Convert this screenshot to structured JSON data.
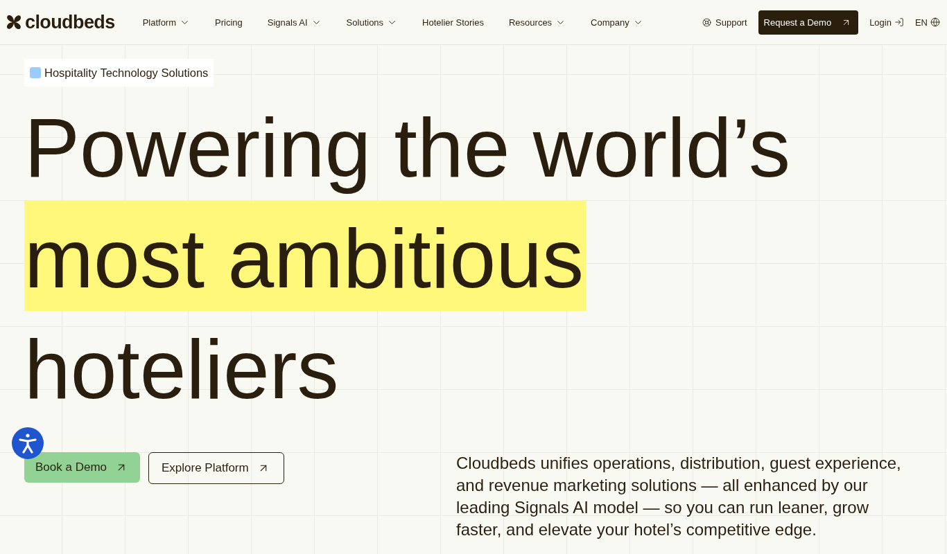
{
  "header": {
    "logo": "cloudbeds",
    "nav": [
      {
        "label": "Platform",
        "has_menu": true
      },
      {
        "label": "Pricing",
        "has_menu": false
      },
      {
        "label": "Signals AI",
        "has_menu": true
      },
      {
        "label": "Solutions",
        "has_menu": true
      },
      {
        "label": "Hotelier Stories",
        "has_menu": false
      },
      {
        "label": "Resources",
        "has_menu": true
      },
      {
        "label": "Company",
        "has_menu": true
      }
    ],
    "support": "Support",
    "demo_button": "Request a Demo",
    "login": "Login",
    "language": "EN"
  },
  "hero": {
    "tag": "Hospitality Technology Solutions",
    "headline": [
      {
        "text": "Powering the world’s",
        "highlighted": false
      },
      {
        "text": "most ambitious",
        "highlighted": true
      },
      {
        "text": "hoteliers",
        "highlighted": false
      }
    ],
    "buttons": [
      {
        "label": "Book a Demo",
        "kind": "primary"
      },
      {
        "label": "Explore Platform",
        "kind": "outline"
      }
    ],
    "description": "Cloudbeds unifies operations, distribution, guest experience, and revenue marketing solutions — all enhanced by our leading Signals AI model — so you can run leaner, grow faster, and elevate your hotel’s competitive edge."
  }
}
